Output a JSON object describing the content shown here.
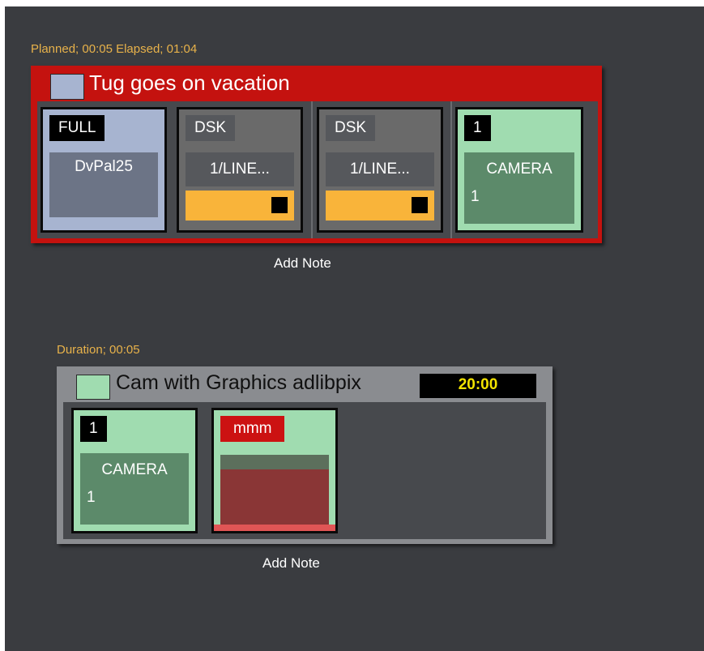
{
  "colors": {
    "background": "#3a3c40",
    "meta_text": "#e8b24a",
    "group1_frame": "#c4120f",
    "group2_frame": "#8a8c90",
    "full_card": "#a7b4d0",
    "dsk_card": "#6a6a6a",
    "camera_card": "#a0dcb0",
    "graphics_card": "#a0dcb0",
    "graphics_border": "#e05555",
    "progress_bar": "#f9b43a",
    "timer_text": "#f2e300"
  },
  "segment1": {
    "meta": "Planned;  00:05 Elapsed; 01:04",
    "title": "Tug goes on vacation",
    "swatch_color": "#a7b4d0",
    "cards": [
      {
        "badge": "FULL",
        "name": "DvPal25",
        "icon": "none"
      },
      {
        "badge": "DSK",
        "name": "1/LINE...",
        "icon": "stop-square-icon"
      },
      {
        "badge": "DSK",
        "name": "1/LINE...",
        "icon": "stop-square-icon"
      },
      {
        "badge": "1",
        "name_line1": "CAMERA",
        "name_line2": "1"
      }
    ],
    "add_note": "Add Note"
  },
  "segment2": {
    "meta": "Duration; 00:05",
    "title": "Cam with Graphics adlibpix",
    "timer": "20:00",
    "swatch_color": "#a0dcb0",
    "cards": [
      {
        "badge": "1",
        "name_line1": "CAMERA",
        "name_line2": "1"
      },
      {
        "badge": "mmm"
      }
    ],
    "add_note": "Add Note"
  }
}
